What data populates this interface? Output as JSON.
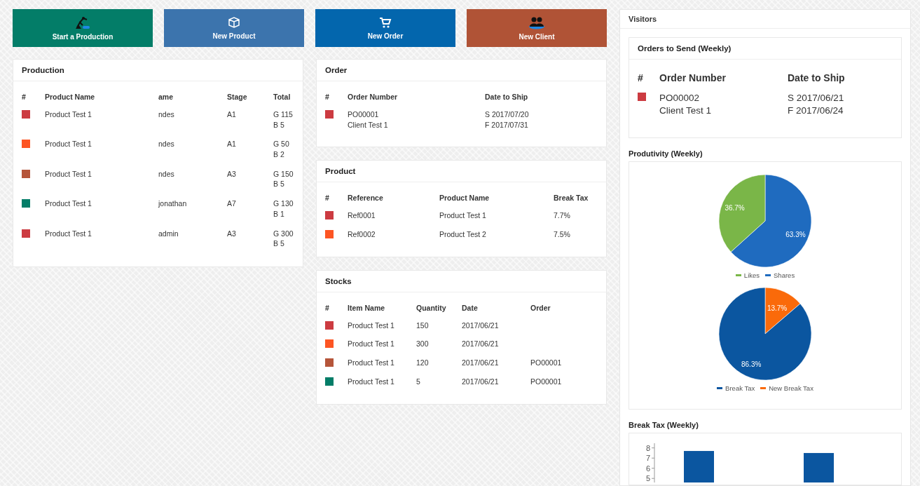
{
  "buttons": [
    {
      "label": "Start a Production",
      "kind": "production",
      "color": "#037d68"
    },
    {
      "label": "New Product",
      "kind": "product",
      "color": "#3c74ad"
    },
    {
      "label": "New Order",
      "kind": "order",
      "color": "#0366ad"
    },
    {
      "label": "New Client",
      "kind": "client",
      "color": "#b05336"
    }
  ],
  "production": {
    "title": "Production",
    "columns": [
      "#",
      "Product Name",
      "ame",
      "Stage",
      "Total"
    ],
    "rows": [
      {
        "color": "#cc3b41",
        "cells": [
          "",
          "Product Test 1",
          "ndes",
          "A1",
          "G 115\nB 5"
        ]
      },
      {
        "color": "#fd5523",
        "cells": [
          "",
          "Product Test 1",
          "ndes",
          "A1",
          "G 50\nB 2"
        ]
      },
      {
        "color": "#b5553a",
        "cells": [
          "",
          "Product Test 1",
          "ndes",
          "A3",
          "G 150\nB 5"
        ]
      },
      {
        "color": "#037d68",
        "cells": [
          "",
          "Product Test 1",
          "jonathan",
          "A7",
          "G 130\nB 1"
        ]
      },
      {
        "color": "#cc3b41",
        "cells": [
          "",
          "Product Test 1",
          "admin",
          "A3",
          "G 300\nB 5"
        ]
      }
    ]
  },
  "order": {
    "title": "Order",
    "columns": [
      "#",
      "Order Number",
      "Date to Ship"
    ],
    "rows": [
      {
        "color": "#cc3b41",
        "cells": [
          "",
          "PO00001\nClient Test 1",
          "S 2017/07/20\nF 2017/07/31"
        ]
      }
    ]
  },
  "product": {
    "title": "Product",
    "columns": [
      "#",
      "Reference",
      "Product Name",
      "Break Tax"
    ],
    "rows": [
      {
        "color": "#cc3b41",
        "cells": [
          "",
          "Ref0001",
          "Product Test 1",
          "7.7%"
        ]
      },
      {
        "color": "#fd5523",
        "cells": [
          "",
          "Ref0002",
          "Product Test 2",
          "7.5%"
        ]
      }
    ]
  },
  "stocks": {
    "title": "Stocks",
    "columns": [
      "#",
      "Item Name",
      "Quantity",
      "Date",
      "Order"
    ],
    "rows": [
      {
        "color": "#cc3b41",
        "cells": [
          "",
          "Product Test 1",
          "150",
          "2017/06/21",
          ""
        ]
      },
      {
        "color": "#fd5523",
        "cells": [
          "",
          "Product Test 1",
          "300",
          "2017/06/21",
          ""
        ]
      },
      {
        "color": "#b5553a",
        "cells": [
          "",
          "Product Test 1",
          "120",
          "2017/06/21",
          "PO00001"
        ]
      },
      {
        "color": "#037d68",
        "cells": [
          "",
          "Product Test 1",
          "5",
          "2017/06/21",
          "PO00001"
        ]
      }
    ]
  },
  "visitors": {
    "title": "Visitors",
    "orders_to_send": {
      "title": "Orders to Send (Weekly)",
      "columns": [
        "#",
        "Order Number",
        "Date to Ship"
      ],
      "rows": [
        {
          "color": "#cc3b41",
          "cells": [
            "",
            "PO00002\nClient Test 1",
            "S 2017/06/21\nF 2017/06/24"
          ]
        }
      ]
    },
    "productivity": {
      "title": "Produtivity (Weekly)",
      "charts": [
        {
          "chart_data": {
            "type": "pie",
            "categories": [
              "Likes",
              "Shares"
            ],
            "values": [
              36.7,
              63.3
            ],
            "colors": [
              "#7ab648",
              "#1f6bbf"
            ],
            "value_labels": [
              "36.7%",
              "63.3%"
            ]
          }
        },
        {
          "chart_data": {
            "type": "pie",
            "categories": [
              "Break Tax",
              "New Break Tax"
            ],
            "values": [
              86.3,
              13.7
            ],
            "colors": [
              "#0b56a0",
              "#fa6a0a"
            ],
            "value_labels": [
              "86.3%",
              "13.7%"
            ]
          }
        }
      ]
    },
    "break_tax": {
      "title": "Break Tax (Weekly)",
      "chart_data": {
        "type": "bar",
        "orientation": "vertical",
        "categories": [
          null,
          null
        ],
        "series": [
          {
            "color": "#0b56a0",
            "values": [
              7.7,
              7.5
            ]
          }
        ],
        "ylim": [
          4.6,
          8.6
        ],
        "yticks": [
          5,
          6,
          7,
          8
        ]
      }
    }
  }
}
